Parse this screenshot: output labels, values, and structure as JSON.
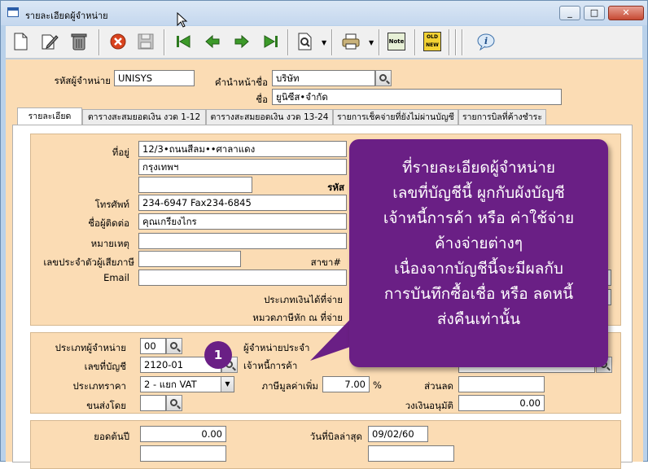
{
  "window": {
    "title": "รายละเอียดผู้จำหน่าย",
    "min": "_",
    "max": "□",
    "close": "✕"
  },
  "toolbar": {
    "buttons": [
      "new-icon",
      "edit-icon",
      "trash-icon",
      "cancel-icon",
      "save-icon",
      "first-icon",
      "prev-icon",
      "next-icon",
      "last-icon",
      "find-icon",
      "print-icon",
      "note-icon",
      "old-new-icon",
      "info-icon"
    ],
    "note_label": "Note",
    "old_new_label": "OLD NEW"
  },
  "header": {
    "vendor_code_label": "รหัสผู้จำหน่าย",
    "vendor_code": "UNISYS",
    "prefix_label": "คำนำหน้าชื่อ",
    "prefix": "บริษัท",
    "name_label": "ชื่อ",
    "name": "ยูนิซีส•จำกัด"
  },
  "tabs": [
    "รายละเอียด",
    "ตารางสะสมยอดเงิน งวด 1-12",
    "ตารางสะสมยอดเงิน งวด 13-24",
    "รายการเช็คจ่ายที่ยังไม่ผ่านบัญชี",
    "รายการบิลที่ค้างชำระ"
  ],
  "details": {
    "address_label": "ที่อยู่",
    "address1": "12/3•ถนนสีลม••ศาลาแดง",
    "address2": "กรุงเทพฯ",
    "address3": "",
    "postcode_label_partial": "รหัส",
    "phone_label": "โทรศัพท์",
    "phone": "234-6947  Fax234-6845",
    "contact_label": "ชื่อผู้ติดต่อ",
    "contact": "คุณเกรียงไกร",
    "remark_label": "หมายเหตุ",
    "remark": "",
    "tax_id_label": "เลขประจำตัวผู้เสียภาษี",
    "tax_id": "",
    "branch_label": "สาขา#",
    "email_label": "Email",
    "email": "",
    "pay_type_label": "ประเภทเงินได้ที่จ่าย",
    "withhold_label": "หมวดภาษีหัก ณ ที่จ่าย",
    "right_value_partial": "0"
  },
  "vendor": {
    "type_label": "ประเภทผู้จำหน่าย",
    "type": "00",
    "account_label": "เลขที่บัญชี",
    "account": "2120-01",
    "price_type_label": "ประเภทราคา",
    "price_type": "2 - แยก VAT",
    "ship_label": "ขนส่งโดย",
    "ship": "",
    "regular_label_1": "ผู้จำหน่ายประจำ",
    "regular_label_2": "เจ้าหนี้การค้า",
    "vat_label": "ภาษีมูลค่าเพิ่ม",
    "vat": "7.00",
    "vat_unit": "%",
    "discount_label": "ส่วนลด",
    "discount": "",
    "credit_label": "วงเงินอนุมัติ",
    "credit": "0.00"
  },
  "balance": {
    "opening_label": "ยอดต้นปี",
    "opening": "0.00",
    "last_bill_label": "วันที่บิลล่าสุด",
    "last_bill": "09/02/60"
  },
  "callout": {
    "badge": "1",
    "lines": [
      "ที่รายละเอียดผู้จำหน่าย",
      "เลขที่บัญชีนี้ ผูกกับผังบัญชี",
      "เจ้าหนี้การค้า หรือ ค่าใช้จ่าย",
      "ค้างจ่ายต่างๆ",
      "เนื่องจากบัญชีนี้จะมีผลกับ",
      "การบันทึกซื้อเชื่อ หรือ ลดหนี้",
      "ส่งคืนเท่านั้น"
    ]
  },
  "colors": {
    "client_bg": "#fbdcb4",
    "callout": "#6a1f85"
  }
}
